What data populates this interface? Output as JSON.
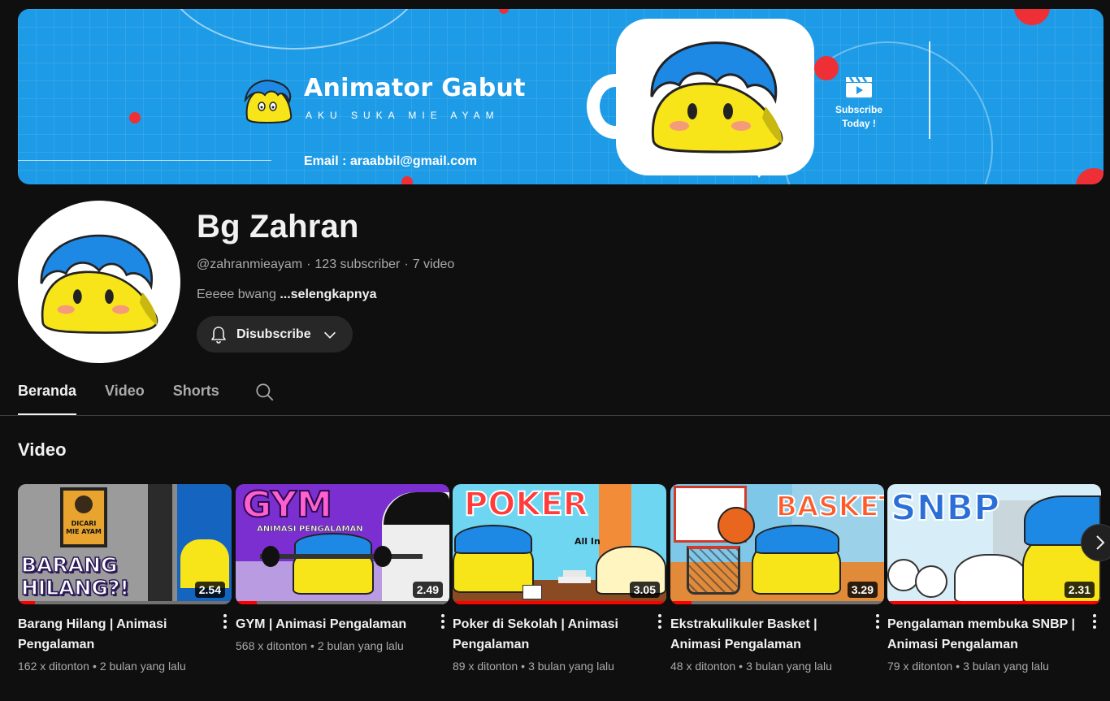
{
  "banner": {
    "title": "Animator Gabut",
    "tagline": "AKU SUKA MIE AYAM",
    "email": "Email : araabbil@gmail.com",
    "cta_line1": "Subscribe",
    "cta_line2": "Today !",
    "colors": {
      "background": "#1e9be6",
      "dots": "#ee2f35"
    }
  },
  "channel": {
    "name": "Bg Zahran",
    "handle": "@zahranmieayam",
    "subscribers": "123 subscriber",
    "video_count": "7 video",
    "separator": "·",
    "description": "Eeeee bwang",
    "more_label": "...selengkapnya",
    "subscribe_label": "Disubscribe"
  },
  "tabs": [
    {
      "label": "Beranda",
      "active": true
    },
    {
      "label": "Video",
      "active": false
    },
    {
      "label": "Shorts",
      "active": false
    }
  ],
  "section": {
    "title": "Video"
  },
  "videos": [
    {
      "title": "Barang Hilang | Animasi Pengalaman",
      "views": "162 x ditonton",
      "age": "2 bulan yang lalu",
      "duration": "2.54",
      "thumb_text": "BARANG HILANG?!",
      "thumb_sign": "DICARI MIE AYAM",
      "watched": 0.08
    },
    {
      "title": "GYM | Animasi Pengalaman",
      "views": "568 x ditonton",
      "age": "2 bulan yang lalu",
      "duration": "2.49",
      "thumb_text": "GYM",
      "thumb_sub": "ANIMASI PENGALAMAN",
      "watched": 0.1
    },
    {
      "title": "Poker di Sekolah | Animasi Pengalaman",
      "views": "89 x ditonton",
      "age": "3 bulan yang lalu",
      "duration": "3.05",
      "thumb_text": "POKER",
      "thumb_sub": "All In",
      "watched": 1.0
    },
    {
      "title": "Ekstrakulikuler Basket | Animasi Pengalaman",
      "views": "48 x ditonton",
      "age": "3 bulan yang lalu",
      "duration": "3.29",
      "thumb_text": "BASKET",
      "watched": 0.1
    },
    {
      "title": "Pengalaman membuka SNBP | Animasi Pengalaman",
      "views": "79 x ditonton",
      "age": "3 bulan yang lalu",
      "duration": "2.31",
      "thumb_text": "SNBP",
      "watched": 1.0
    }
  ],
  "icons": {
    "bell": "bell-icon",
    "chevron": "chevron-down-icon",
    "search": "search-icon",
    "next": "chevron-right-icon",
    "menu": "more-vert-icon"
  }
}
